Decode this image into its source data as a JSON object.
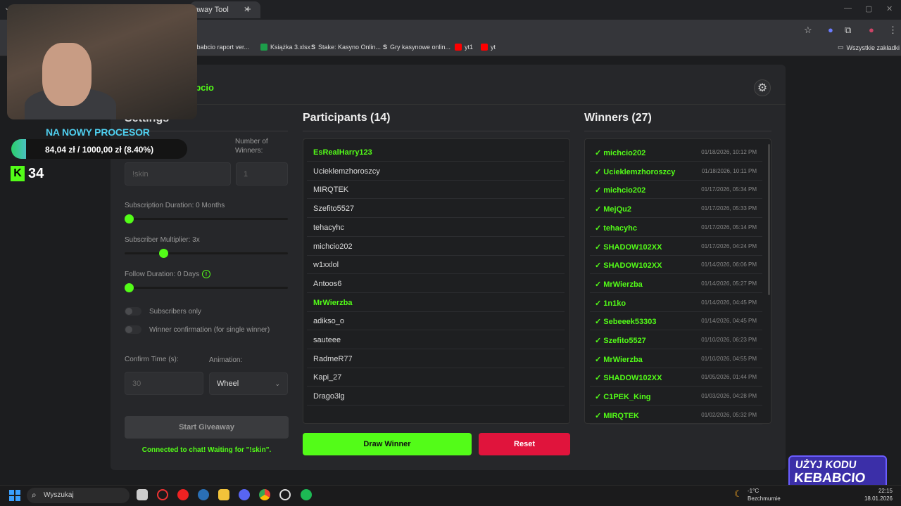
{
  "browser": {
    "tab_title": "eaway Tool",
    "tab_close": "✕",
    "new_tab": "+",
    "bookmarks": [
      {
        "label": "kebabcio raport ver...",
        "color": "#888888"
      },
      {
        "label": "Książka 3.xlsx",
        "color": "#1d9e4a"
      },
      {
        "label": "Stake: Kasyno Onlin...",
        "color": "#ffffff"
      },
      {
        "label": "Gry kasynowe onlin...",
        "color": "#ffffff"
      },
      {
        "label": "yt1",
        "color": "#ff0000"
      },
      {
        "label": "yt",
        "color": "#ff0000"
      }
    ],
    "all_bookmarks": "Wszystkie zakładki"
  },
  "overlay": {
    "promo_title": "NA NOWY PROCESOR",
    "progress_text": "84,04 zł  /  1000,00 zł (8.40%)",
    "progress_percent": 8.4,
    "kick_logo": "K",
    "kick_count": "34",
    "banner_line1": "UŻYJ KODU",
    "banner_line2": "KEBABCIO"
  },
  "app": {
    "brand": "abcio",
    "settings": {
      "title": "Settings",
      "number_of_winners_label": "Number of Winners:",
      "keyword_placeholder": "!skin",
      "winners_value": "1",
      "sub_duration_label": "Subscription Duration: 0 Months",
      "sub_multiplier_label": "Subscriber Multiplier: 3x",
      "follow_duration_label": "Follow Duration: 0 Days",
      "subscribers_only_label": "Subscribers only",
      "winner_confirmation_label": "Winner confirmation (for single winner)",
      "confirm_time_label": "Confirm Time (s):",
      "confirm_time_value": "30",
      "animation_label": "Animation:",
      "animation_value": "Wheel",
      "start_button": "Start Giveaway",
      "status": "Connected to chat! Waiting for \"!skin\"."
    },
    "participants": {
      "title": "Participants (14)",
      "items": [
        {
          "name": "EsRealHarry123",
          "highlight": true
        },
        {
          "name": "Ucieklemzhoroszcy",
          "highlight": false
        },
        {
          "name": "MIRQTEK",
          "highlight": false
        },
        {
          "name": "Szefito5527",
          "highlight": false
        },
        {
          "name": "tehacyhc",
          "highlight": false
        },
        {
          "name": "michcio202",
          "highlight": false
        },
        {
          "name": "w1xxlol",
          "highlight": false
        },
        {
          "name": "Antoos6",
          "highlight": false
        },
        {
          "name": "MrWierzba",
          "highlight": true
        },
        {
          "name": "adikso_o",
          "highlight": false
        },
        {
          "name": "sauteee",
          "highlight": false
        },
        {
          "name": "RadmeR77",
          "highlight": false
        },
        {
          "name": "Kapi_27",
          "highlight": false
        },
        {
          "name": "Drago3lg",
          "highlight": false
        }
      ]
    },
    "winners": {
      "title": "Winners (27)",
      "items": [
        {
          "name": "✓ michcio202",
          "date": "01/18/2026, 10:12 PM"
        },
        {
          "name": "✓ Ucieklemzhoroszcy",
          "date": "01/18/2026, 10:11 PM"
        },
        {
          "name": "✓ michcio202",
          "date": "01/17/2026, 05:34 PM"
        },
        {
          "name": "✓ MejQu2",
          "date": "01/17/2026, 05:33 PM"
        },
        {
          "name": "✓ tehacyhc",
          "date": "01/17/2026, 05:14 PM"
        },
        {
          "name": "✓ SHADOW102XX",
          "date": "01/17/2026, 04:24 PM"
        },
        {
          "name": "✓ SHADOW102XX",
          "date": "01/14/2026, 06:06 PM"
        },
        {
          "name": "✓ MrWierzba",
          "date": "01/14/2026, 05:27 PM"
        },
        {
          "name": "✓ 1n1ko",
          "date": "01/14/2026, 04:45 PM"
        },
        {
          "name": "✓ Sebeeek53303",
          "date": "01/14/2026, 04:45 PM"
        },
        {
          "name": "✓ Szefito5527",
          "date": "01/10/2026, 06:23 PM"
        },
        {
          "name": "✓ MrWierzba",
          "date": "01/10/2026, 04:55 PM"
        },
        {
          "name": "✓ SHADOW102XX",
          "date": "01/05/2026, 01:44 PM"
        },
        {
          "name": "✓ C1PEK_King",
          "date": "01/03/2026, 04:28 PM"
        },
        {
          "name": "✓ MIRQTEK",
          "date": "01/02/2026, 05:32 PM"
        }
      ]
    },
    "draw_button": "Draw Winner",
    "reset_button": "Reset"
  },
  "taskbar": {
    "search_label": "Wyszukaj",
    "weather_temp": "-1°C",
    "weather_desc": "Bezchmurnie",
    "time": "22:15",
    "date": "18.01.2026"
  },
  "colors": {
    "accent": "#53fc18",
    "reset": "#e0143c",
    "background": "#1c1d1f",
    "panel": "#26272a"
  }
}
